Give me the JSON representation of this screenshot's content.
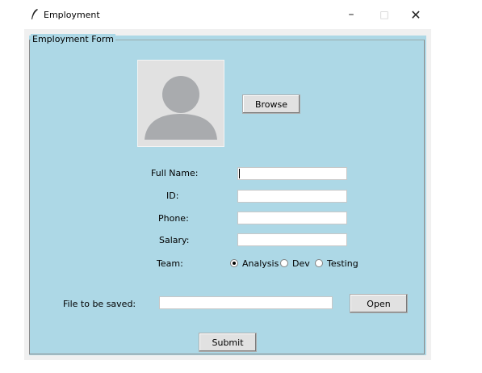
{
  "window": {
    "title": "Employment",
    "min_symbol": "–",
    "max_symbol": "□",
    "close_symbol": "✕"
  },
  "form": {
    "legend": "Employment Form",
    "browse_label": "Browse",
    "fields": {
      "full_name_label": "Full Name:",
      "id_label": "ID:",
      "phone_label": "Phone:",
      "salary_label": "Salary:",
      "full_name_value": "",
      "id_value": "",
      "phone_value": "",
      "salary_value": ""
    },
    "team": {
      "label": "Team:",
      "options": [
        "Analysis",
        "Dev",
        "Testing"
      ],
      "selected": "Analysis"
    },
    "file": {
      "label": "File to be saved:",
      "value": "",
      "open_label": "Open"
    },
    "submit_label": "Submit"
  },
  "icons": {
    "app": "feather-icon",
    "avatar": "user-avatar-icon"
  },
  "colors": {
    "form_bg": "#add8e6",
    "window_bg": "#f0f0f0",
    "button_bg": "#e1e1e1"
  }
}
